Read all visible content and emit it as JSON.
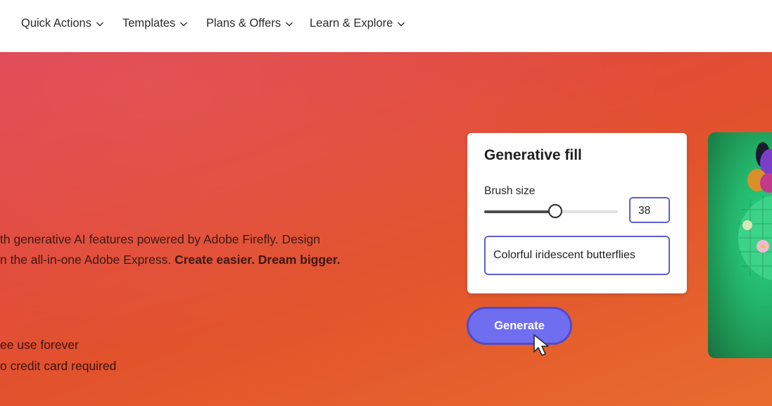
{
  "nav": {
    "items": [
      {
        "label": "Quick Actions"
      },
      {
        "label": "Templates"
      },
      {
        "label": "Plans & Offers"
      },
      {
        "label": "Learn & Explore"
      }
    ]
  },
  "hero": {
    "description_line1": "th generative AI features powered by Adobe Firefly. Design",
    "description_line2_plain": "n the all-in-one Adobe Express.",
    "description_line2_bold": "Create easier. Dream bigger.",
    "feature_1": "ee use forever",
    "feature_2": "o credit card required"
  },
  "generative_fill": {
    "title": "Generative fill",
    "brush_label": "Brush size",
    "brush_size": "38",
    "slider_fraction": 0.53,
    "prompt_text": "Colorful iridescent butterflies",
    "generate_label": "Generate"
  },
  "colors": {
    "accent": "#6f6ef0",
    "accent_border": "#5d5fcf",
    "hero_start": "#e04552",
    "hero_end": "#e86c2e"
  },
  "icons": {
    "nav_chevron": "chevron-down-icon",
    "cursor": "pointer-cursor-icon"
  }
}
